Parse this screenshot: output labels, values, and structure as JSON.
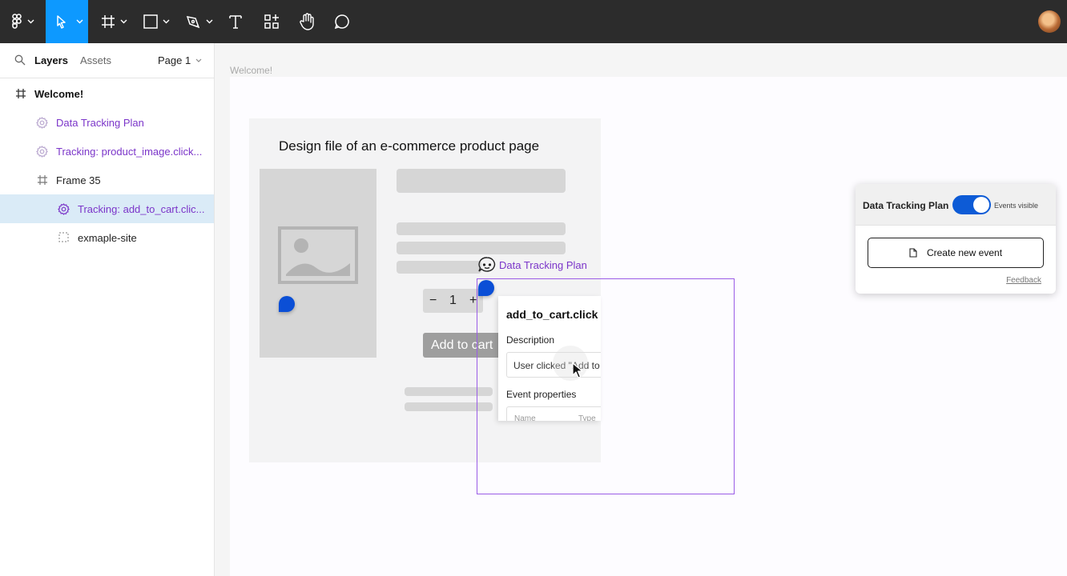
{
  "toolbar": {
    "tools": [
      "main-menu",
      "move",
      "frame",
      "shape",
      "pen",
      "text",
      "resources",
      "hand",
      "comment"
    ],
    "active_tool": "move",
    "accent": "#0d99ff",
    "background": "#2c2c2c"
  },
  "left_panel": {
    "tab_layers": "Layers",
    "tab_assets": "Assets",
    "page": "Page 1",
    "layers": [
      {
        "label": "Welcome!",
        "icon": "frame-icon",
        "level": 0,
        "style": "bold"
      },
      {
        "label": "Data Tracking Plan",
        "icon": "component-gear-icon",
        "level": 1,
        "style": "purple"
      },
      {
        "label": "Tracking: product_image.click...",
        "icon": "component-gear-icon",
        "level": 1,
        "style": "purple"
      },
      {
        "label": "Frame 35",
        "icon": "frame-icon",
        "level": 1,
        "style": "normal"
      },
      {
        "label": "Tracking: add_to_cart.clic...",
        "icon": "component-gear-icon",
        "level": 2,
        "style": "purple",
        "selected": true
      },
      {
        "label": "exmaple-site",
        "icon": "dashed-frame-icon",
        "level": 2,
        "style": "normal"
      }
    ]
  },
  "canvas": {
    "frame_label": "Welcome!",
    "design_title": "Design file of an e-commerce product page",
    "stepper": {
      "minus": "−",
      "value": "1",
      "plus": "+"
    },
    "add_to_cart": "Add to cart",
    "tracking_label": "Data Tracking Plan",
    "popup": {
      "title": "add_to_cart.click",
      "description_label": "Description",
      "description_value": "User clicked \"Add to",
      "properties_label": "Event properties",
      "col_name": "Name",
      "col_type": "Type"
    }
  },
  "plugin": {
    "title": "Data Tracking Plan",
    "toggle_label": "Events visible",
    "toggle_on": true,
    "create_button": "Create new event",
    "feedback": "Feedback",
    "toggle_color": "#0d5bd6"
  }
}
